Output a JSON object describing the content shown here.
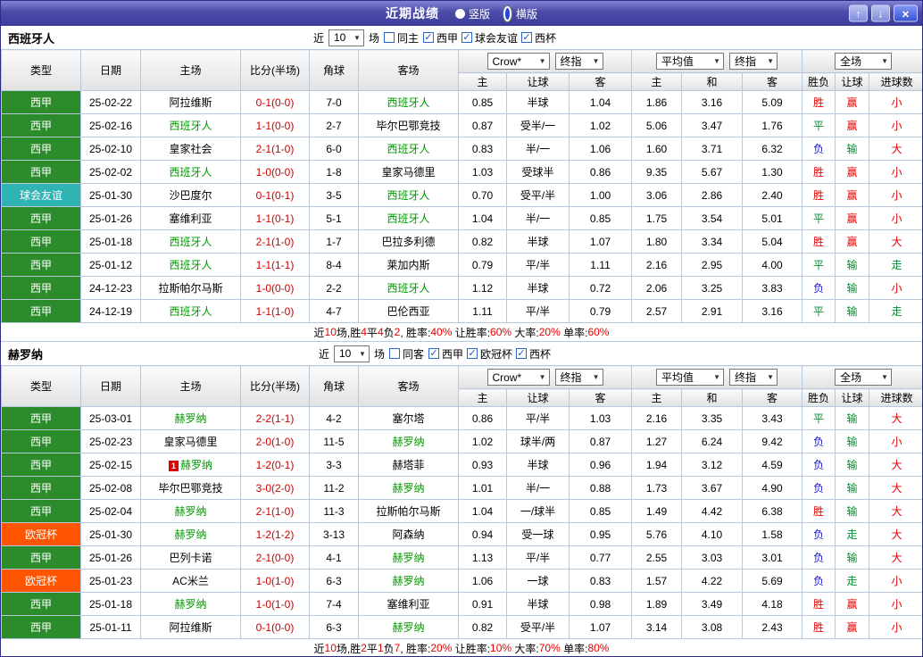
{
  "icons": {
    "check": "✓",
    "dropdown": "▼"
  },
  "colors": {
    "red": "#e60000",
    "green": "#008f2f",
    "blue": "#1414cc",
    "black": "#000000",
    "team_focus": "#009900",
    "score": "#cc0000",
    "league_xijia": "#2c8c2c",
    "league_friendly": "#2fb3b3",
    "league_ucl": "#ff5500"
  },
  "topbar": {
    "title": "近期战绩",
    "radios": [
      {
        "label": "竖版",
        "selected": false
      },
      {
        "label": "横版",
        "selected": true
      }
    ],
    "buttons": {
      "up": "↑",
      "down": "↓",
      "close": "×"
    }
  },
  "filter_labels": {
    "near": "近",
    "matches": "场"
  },
  "columns": {
    "type": "类型",
    "date": "日期",
    "home": "主场",
    "score": "比分(半场)",
    "corner": "角球",
    "away": "客场",
    "dropdowns": {
      "asia_company": "Crow*",
      "asia_index": "终指",
      "euro_company": "平均值",
      "euro_index": "终指",
      "full": "全场"
    },
    "sub": [
      "主",
      "让球",
      "客",
      "主",
      "和",
      "客",
      "胜负",
      "让球",
      "进球数"
    ]
  },
  "sections": [
    {
      "team": "西班牙人",
      "filter": {
        "count": "10",
        "same_label": "同主",
        "same_checked": false,
        "leagues": [
          {
            "label": "西甲",
            "checked": true
          },
          {
            "label": "球会友谊",
            "checked": true
          },
          {
            "label": "西杯",
            "checked": true
          }
        ]
      },
      "rows": [
        {
          "league": "西甲",
          "league_color": "xijia",
          "date": "25-02-22",
          "home": "阿拉维斯",
          "home_focus": false,
          "badge": "",
          "score": "0-1(0-0)",
          "corner": "7-0",
          "away": "西班牙人",
          "away_focus": true,
          "odds": [
            "0.85",
            "半球",
            "1.04",
            "1.86",
            "3.16",
            "5.09"
          ],
          "results": [
            {
              "t": "胜",
              "c": "r"
            },
            {
              "t": "赢",
              "c": "r"
            },
            {
              "t": "小",
              "c": "r"
            }
          ]
        },
        {
          "league": "西甲",
          "league_color": "xijia",
          "date": "25-02-16",
          "home": "西班牙人",
          "home_focus": true,
          "badge": "",
          "score": "1-1(0-0)",
          "corner": "2-7",
          "away": "毕尔巴鄂竞技",
          "away_focus": false,
          "odds": [
            "0.87",
            "受半/一",
            "1.02",
            "5.06",
            "3.47",
            "1.76"
          ],
          "results": [
            {
              "t": "平",
              "c": "g"
            },
            {
              "t": "赢",
              "c": "r"
            },
            {
              "t": "小",
              "c": "r"
            }
          ]
        },
        {
          "league": "西甲",
          "league_color": "xijia",
          "date": "25-02-10",
          "home": "皇家社会",
          "home_focus": false,
          "badge": "",
          "score": "2-1(1-0)",
          "corner": "6-0",
          "away": "西班牙人",
          "away_focus": true,
          "odds": [
            "0.83",
            "半/一",
            "1.06",
            "1.60",
            "3.71",
            "6.32"
          ],
          "results": [
            {
              "t": "负",
              "c": "b"
            },
            {
              "t": "输",
              "c": "g"
            },
            {
              "t": "大",
              "c": "r"
            }
          ]
        },
        {
          "league": "西甲",
          "league_color": "xijia",
          "date": "25-02-02",
          "home": "西班牙人",
          "home_focus": true,
          "badge": "",
          "score": "1-0(0-0)",
          "corner": "1-8",
          "away": "皇家马德里",
          "away_focus": false,
          "odds": [
            "1.03",
            "受球半",
            "0.86",
            "9.35",
            "5.67",
            "1.30"
          ],
          "results": [
            {
              "t": "胜",
              "c": "r"
            },
            {
              "t": "赢",
              "c": "r"
            },
            {
              "t": "小",
              "c": "r"
            }
          ]
        },
        {
          "league": "球会友谊",
          "league_color": "friendly",
          "date": "25-01-30",
          "home": "沙巴度尔",
          "home_focus": false,
          "badge": "",
          "score": "0-1(0-1)",
          "corner": "3-5",
          "away": "西班牙人",
          "away_focus": true,
          "odds": [
            "0.70",
            "受平/半",
            "1.00",
            "3.06",
            "2.86",
            "2.40"
          ],
          "results": [
            {
              "t": "胜",
              "c": "r"
            },
            {
              "t": "赢",
              "c": "r"
            },
            {
              "t": "小",
              "c": "r"
            }
          ]
        },
        {
          "league": "西甲",
          "league_color": "xijia",
          "date": "25-01-26",
          "home": "塞维利亚",
          "home_focus": false,
          "badge": "",
          "score": "1-1(0-1)",
          "corner": "5-1",
          "away": "西班牙人",
          "away_focus": true,
          "odds": [
            "1.04",
            "半/一",
            "0.85",
            "1.75",
            "3.54",
            "5.01"
          ],
          "results": [
            {
              "t": "平",
              "c": "g"
            },
            {
              "t": "赢",
              "c": "r"
            },
            {
              "t": "小",
              "c": "r"
            }
          ]
        },
        {
          "league": "西甲",
          "league_color": "xijia",
          "date": "25-01-18",
          "home": "西班牙人",
          "home_focus": true,
          "badge": "",
          "score": "2-1(1-0)",
          "corner": "1-7",
          "away": "巴拉多利德",
          "away_focus": false,
          "odds": [
            "0.82",
            "半球",
            "1.07",
            "1.80",
            "3.34",
            "5.04"
          ],
          "results": [
            {
              "t": "胜",
              "c": "r"
            },
            {
              "t": "赢",
              "c": "r"
            },
            {
              "t": "大",
              "c": "r"
            }
          ]
        },
        {
          "league": "西甲",
          "league_color": "xijia",
          "date": "25-01-12",
          "home": "西班牙人",
          "home_focus": true,
          "badge": "",
          "score": "1-1(1-1)",
          "corner": "8-4",
          "away": "莱加内斯",
          "away_focus": false,
          "odds": [
            "0.79",
            "平/半",
            "1.11",
            "2.16",
            "2.95",
            "4.00"
          ],
          "results": [
            {
              "t": "平",
              "c": "g"
            },
            {
              "t": "输",
              "c": "g"
            },
            {
              "t": "走",
              "c": "g"
            }
          ]
        },
        {
          "league": "西甲",
          "league_color": "xijia",
          "date": "24-12-23",
          "home": "拉斯帕尔马斯",
          "home_focus": false,
          "badge": "",
          "score": "1-0(0-0)",
          "corner": "2-2",
          "away": "西班牙人",
          "away_focus": true,
          "odds": [
            "1.12",
            "半球",
            "0.72",
            "2.06",
            "3.25",
            "3.83"
          ],
          "results": [
            {
              "t": "负",
              "c": "b"
            },
            {
              "t": "输",
              "c": "g"
            },
            {
              "t": "小",
              "c": "r"
            }
          ]
        },
        {
          "league": "西甲",
          "league_color": "xijia",
          "date": "24-12-19",
          "home": "西班牙人",
          "home_focus": true,
          "badge": "",
          "score": "1-1(1-0)",
          "corner": "4-7",
          "away": "巴伦西亚",
          "away_focus": false,
          "odds": [
            "1.11",
            "平/半",
            "0.79",
            "2.57",
            "2.91",
            "3.16"
          ],
          "results": [
            {
              "t": "平",
              "c": "g"
            },
            {
              "t": "输",
              "c": "g"
            },
            {
              "t": "走",
              "c": "g"
            }
          ]
        }
      ],
      "summary": [
        {
          "t": "近",
          "c": "k"
        },
        {
          "t": "10",
          "c": "r"
        },
        {
          "t": "场,胜",
          "c": "k"
        },
        {
          "t": "4",
          "c": "r"
        },
        {
          "t": "平",
          "c": "k"
        },
        {
          "t": "4",
          "c": "r"
        },
        {
          "t": "负",
          "c": "k"
        },
        {
          "t": "2",
          "c": "r"
        },
        {
          "t": ", 胜率:",
          "c": "k"
        },
        {
          "t": "40%",
          "c": "r"
        },
        {
          "t": " 让胜率:",
          "c": "k"
        },
        {
          "t": "60%",
          "c": "r"
        },
        {
          "t": " 大率:",
          "c": "k"
        },
        {
          "t": "20%",
          "c": "r"
        },
        {
          "t": " 单率:",
          "c": "k"
        },
        {
          "t": "60%",
          "c": "r"
        }
      ]
    },
    {
      "team": "赫罗纳",
      "filter": {
        "count": "10",
        "same_label": "同客",
        "same_checked": false,
        "leagues": [
          {
            "label": "西甲",
            "checked": true
          },
          {
            "label": "欧冠杯",
            "checked": true
          },
          {
            "label": "西杯",
            "checked": true
          }
        ]
      },
      "rows": [
        {
          "league": "西甲",
          "league_color": "xijia",
          "date": "25-03-01",
          "home": "赫罗纳",
          "home_focus": true,
          "badge": "",
          "score": "2-2(1-1)",
          "corner": "4-2",
          "away": "塞尔塔",
          "away_focus": false,
          "odds": [
            "0.86",
            "平/半",
            "1.03",
            "2.16",
            "3.35",
            "3.43"
          ],
          "results": [
            {
              "t": "平",
              "c": "g"
            },
            {
              "t": "输",
              "c": "g"
            },
            {
              "t": "大",
              "c": "r"
            }
          ]
        },
        {
          "league": "西甲",
          "league_color": "xijia",
          "date": "25-02-23",
          "home": "皇家马德里",
          "home_focus": false,
          "badge": "",
          "score": "2-0(1-0)",
          "corner": "11-5",
          "away": "赫罗纳",
          "away_focus": true,
          "odds": [
            "1.02",
            "球半/两",
            "0.87",
            "1.27",
            "6.24",
            "9.42"
          ],
          "results": [
            {
              "t": "负",
              "c": "b"
            },
            {
              "t": "输",
              "c": "g"
            },
            {
              "t": "小",
              "c": "r"
            }
          ]
        },
        {
          "league": "西甲",
          "league_color": "xijia",
          "date": "25-02-15",
          "home": "赫罗纳",
          "home_focus": true,
          "badge": "1",
          "score": "1-2(0-1)",
          "corner": "3-3",
          "away": "赫塔菲",
          "away_focus": false,
          "odds": [
            "0.93",
            "半球",
            "0.96",
            "1.94",
            "3.12",
            "4.59"
          ],
          "results": [
            {
              "t": "负",
              "c": "b"
            },
            {
              "t": "输",
              "c": "g"
            },
            {
              "t": "大",
              "c": "r"
            }
          ]
        },
        {
          "league": "西甲",
          "league_color": "xijia",
          "date": "25-02-08",
          "home": "毕尔巴鄂竞技",
          "home_focus": false,
          "badge": "",
          "score": "3-0(2-0)",
          "corner": "11-2",
          "away": "赫罗纳",
          "away_focus": true,
          "odds": [
            "1.01",
            "半/一",
            "0.88",
            "1.73",
            "3.67",
            "4.90"
          ],
          "results": [
            {
              "t": "负",
              "c": "b"
            },
            {
              "t": "输",
              "c": "g"
            },
            {
              "t": "大",
              "c": "r"
            }
          ]
        },
        {
          "league": "西甲",
          "league_color": "xijia",
          "date": "25-02-04",
          "home": "赫罗纳",
          "home_focus": true,
          "badge": "",
          "score": "2-1(1-0)",
          "corner": "11-3",
          "away": "拉斯帕尔马斯",
          "away_focus": false,
          "odds": [
            "1.04",
            "一/球半",
            "0.85",
            "1.49",
            "4.42",
            "6.38"
          ],
          "results": [
            {
              "t": "胜",
              "c": "r"
            },
            {
              "t": "输",
              "c": "g"
            },
            {
              "t": "大",
              "c": "r"
            }
          ]
        },
        {
          "league": "欧冠杯",
          "league_color": "ucl",
          "date": "25-01-30",
          "home": "赫罗纳",
          "home_focus": true,
          "badge": "",
          "score": "1-2(1-2)",
          "corner": "3-13",
          "away": "阿森纳",
          "away_focus": false,
          "odds": [
            "0.94",
            "受一球",
            "0.95",
            "5.76",
            "4.10",
            "1.58"
          ],
          "results": [
            {
              "t": "负",
              "c": "b"
            },
            {
              "t": "走",
              "c": "g"
            },
            {
              "t": "大",
              "c": "r"
            }
          ]
        },
        {
          "league": "西甲",
          "league_color": "xijia",
          "date": "25-01-26",
          "home": "巴列卡诺",
          "home_focus": false,
          "badge": "",
          "score": "2-1(0-0)",
          "corner": "4-1",
          "away": "赫罗纳",
          "away_focus": true,
          "odds": [
            "1.13",
            "平/半",
            "0.77",
            "2.55",
            "3.03",
            "3.01"
          ],
          "results": [
            {
              "t": "负",
              "c": "b"
            },
            {
              "t": "输",
              "c": "g"
            },
            {
              "t": "大",
              "c": "r"
            }
          ]
        },
        {
          "league": "欧冠杯",
          "league_color": "ucl",
          "date": "25-01-23",
          "home": "AC米兰",
          "home_focus": false,
          "badge": "",
          "score": "1-0(1-0)",
          "corner": "6-3",
          "away": "赫罗纳",
          "away_focus": true,
          "odds": [
            "1.06",
            "一球",
            "0.83",
            "1.57",
            "4.22",
            "5.69"
          ],
          "results": [
            {
              "t": "负",
              "c": "b"
            },
            {
              "t": "走",
              "c": "g"
            },
            {
              "t": "小",
              "c": "r"
            }
          ]
        },
        {
          "league": "西甲",
          "league_color": "xijia",
          "date": "25-01-18",
          "home": "赫罗纳",
          "home_focus": true,
          "badge": "",
          "score": "1-0(1-0)",
          "corner": "7-4",
          "away": "塞维利亚",
          "away_focus": false,
          "odds": [
            "0.91",
            "半球",
            "0.98",
            "1.89",
            "3.49",
            "4.18"
          ],
          "results": [
            {
              "t": "胜",
              "c": "r"
            },
            {
              "t": "赢",
              "c": "r"
            },
            {
              "t": "小",
              "c": "r"
            }
          ]
        },
        {
          "league": "西甲",
          "league_color": "xijia",
          "date": "25-01-11",
          "home": "阿拉维斯",
          "home_focus": false,
          "badge": "",
          "score": "0-1(0-0)",
          "corner": "6-3",
          "away": "赫罗纳",
          "away_focus": true,
          "odds": [
            "0.82",
            "受平/半",
            "1.07",
            "3.14",
            "3.08",
            "2.43"
          ],
          "results": [
            {
              "t": "胜",
              "c": "r"
            },
            {
              "t": "赢",
              "c": "r"
            },
            {
              "t": "小",
              "c": "r"
            }
          ]
        }
      ],
      "summary": [
        {
          "t": "近",
          "c": "k"
        },
        {
          "t": "10",
          "c": "r"
        },
        {
          "t": "场,胜",
          "c": "k"
        },
        {
          "t": "2",
          "c": "r"
        },
        {
          "t": "平",
          "c": "k"
        },
        {
          "t": "1",
          "c": "r"
        },
        {
          "t": "负",
          "c": "k"
        },
        {
          "t": "7",
          "c": "r"
        },
        {
          "t": ", 胜率:",
          "c": "k"
        },
        {
          "t": "20%",
          "c": "r"
        },
        {
          "t": " 让胜率:",
          "c": "k"
        },
        {
          "t": "10%",
          "c": "r"
        },
        {
          "t": " 大率:",
          "c": "k"
        },
        {
          "t": "70%",
          "c": "r"
        },
        {
          "t": " 单率:",
          "c": "k"
        },
        {
          "t": "80%",
          "c": "r"
        }
      ]
    }
  ]
}
